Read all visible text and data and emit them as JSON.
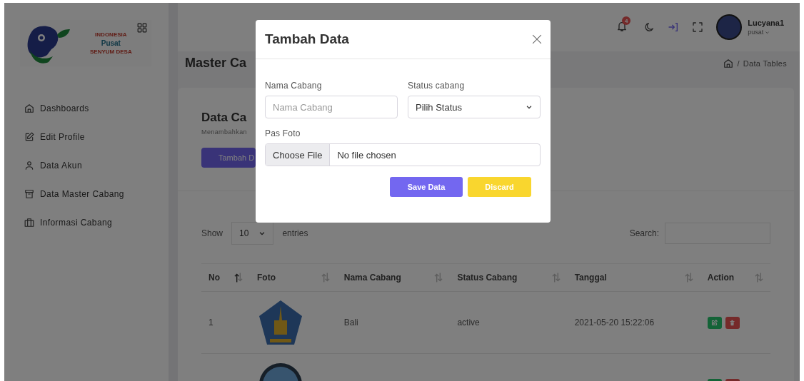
{
  "sidebar": {
    "logo": {
      "lines": [
        "INDONESIA",
        "Pusat",
        "SENYUM DESA"
      ]
    },
    "menu": [
      {
        "label": "Dashboards"
      },
      {
        "label": "Edit Profile"
      },
      {
        "label": "Data Akun"
      },
      {
        "label": "Data Master Cabang"
      },
      {
        "label": "Informasi Cabang"
      }
    ]
  },
  "topbar": {
    "notification_count": "4",
    "user": {
      "name": "Lucyana1",
      "role": "pusat"
    }
  },
  "breadcrumb": {
    "separator": "/",
    "current": "Data Tables"
  },
  "page_title": "Master Ca",
  "card": {
    "title": "Data Ca",
    "subtitle": "Menambahkan",
    "button": "Tambah D"
  },
  "table": {
    "length": {
      "label_before": "Show",
      "value": "10",
      "label_after": "entries"
    },
    "search_label": "Search:",
    "columns": [
      {
        "label": "No",
        "sorted": true
      },
      {
        "label": "Foto",
        "sorted": false
      },
      {
        "label": "Nama Cabang",
        "sorted": false
      },
      {
        "label": "Status Cabang",
        "sorted": false
      },
      {
        "label": "Tanggal",
        "sorted": false
      },
      {
        "label": "Action",
        "sorted": false
      }
    ],
    "rows": [
      {
        "no": "1",
        "nama": "Bali",
        "status": "active",
        "tanggal": "2021-05-20 15:22:06"
      },
      {}
    ]
  },
  "modal": {
    "title": "Tambah Data",
    "fields": [
      {
        "label": "Nama Cabang",
        "kind": "text",
        "placeholder": "Nama Cabang"
      },
      {
        "label": "Status cabang",
        "kind": "select",
        "value": "Pilih Status"
      },
      {
        "label": "Pas Foto",
        "kind": "file",
        "button": "Choose File",
        "value": "No file chosen"
      }
    ],
    "buttons": [
      {
        "label": "Save Data",
        "kind": "primary"
      },
      {
        "label": "Discard",
        "kind": "warning"
      }
    ]
  }
}
